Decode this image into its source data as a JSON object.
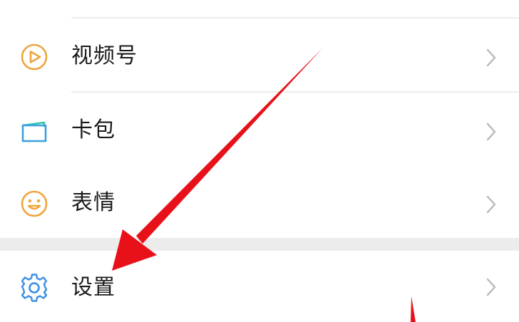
{
  "menu": {
    "items": [
      {
        "label": "视频号",
        "icon": "play-circle-icon",
        "color": "#F0A43C"
      },
      {
        "label": "卡包",
        "icon": "card-wallet-icon",
        "color": "#3B9FE0"
      },
      {
        "label": "表情",
        "icon": "smiley-icon",
        "color": "#F0A43C"
      },
      {
        "label": "设置",
        "icon": "gear-icon",
        "color": "#3B8FE6"
      }
    ]
  },
  "colors": {
    "divider": "#EDEDED",
    "section_gap": "#ECECEC",
    "chevron": "#B8B8B8",
    "annotation_arrow": "#E8111A"
  }
}
